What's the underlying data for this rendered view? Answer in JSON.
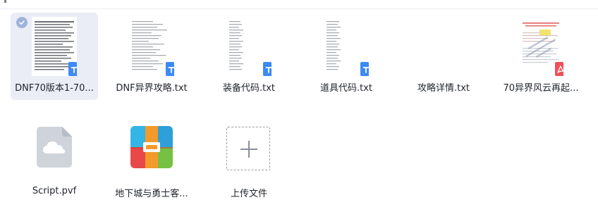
{
  "files": [
    {
      "name": "DNF70版本1-70...",
      "type": "txt",
      "icon": "txt-badge-icon",
      "selected": true
    },
    {
      "name": "DNF异界攻略.txt",
      "type": "txt",
      "icon": "txt-badge-icon",
      "selected": false
    },
    {
      "name": "装备代码.txt",
      "type": "txt",
      "icon": "txt-badge-icon",
      "selected": false
    },
    {
      "name": "道具代码.txt",
      "type": "txt",
      "icon": "txt-badge-icon",
      "selected": false
    },
    {
      "name": "攻略详情.txt",
      "type": "txt",
      "icon": "txt-badge-icon",
      "selected": false
    },
    {
      "name": "70异界风云再起...",
      "type": "pdf",
      "icon": "pdf-badge-icon",
      "selected": false
    }
  ],
  "files_row2": [
    {
      "name": "Script.pvf",
      "type": "pvf",
      "icon": "cloud-file-icon"
    },
    {
      "name": "地下城与勇士客...",
      "type": "app",
      "icon": "app-package-icon"
    }
  ],
  "upload": {
    "label": "上传文件",
    "icon": "plus-icon"
  },
  "colors": {
    "selected_bg": "#eaedf5",
    "txt_badge": "#3d8af7",
    "pdf_badge": "#f0505a",
    "text": "#1f2329"
  }
}
